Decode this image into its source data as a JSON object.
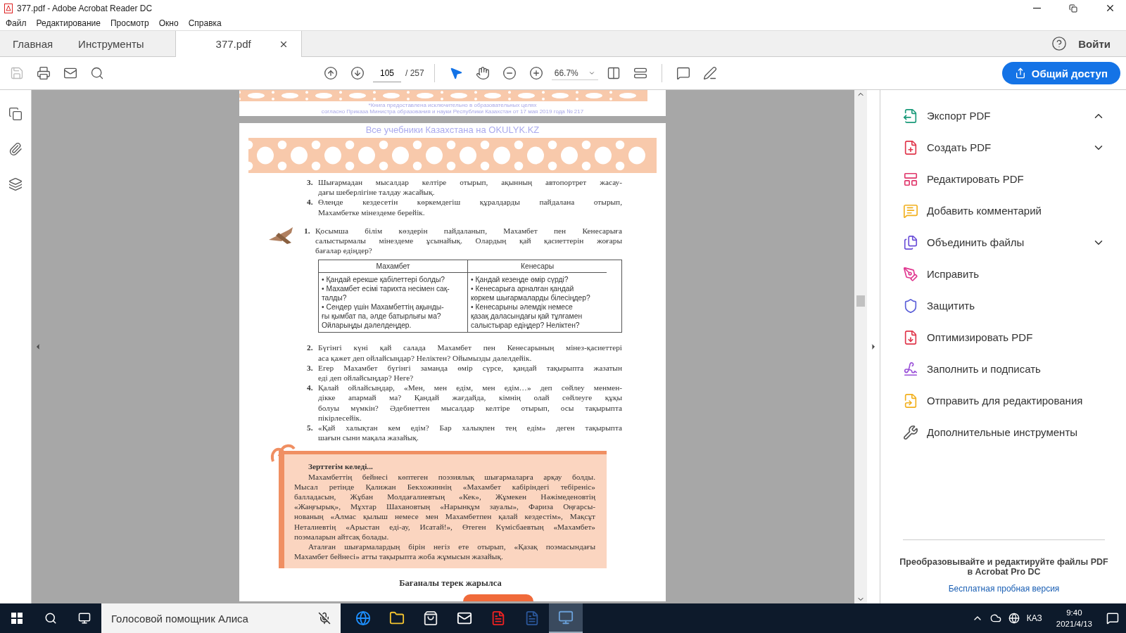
{
  "window": {
    "title": "377.pdf - Adobe Acrobat Reader DC"
  },
  "menu": [
    "Файл",
    "Редактирование",
    "Просмотр",
    "Окно",
    "Справка"
  ],
  "tabs": [
    {
      "label": "Главная",
      "selected": false,
      "kind": "nav"
    },
    {
      "label": "Инструменты",
      "selected": false,
      "kind": "nav"
    },
    {
      "label": "377.pdf",
      "selected": true,
      "kind": "document"
    }
  ],
  "sign_in": "Войти",
  "toolbar": {
    "page": "105",
    "page_total": "/ 257",
    "zoom": "66.7%",
    "share": "Общий доступ"
  },
  "document": {
    "notice": [
      "*Книга предоставлена исключительно в образовательных целях",
      "согласно Приказа Министра образования и науки Республики Казахстан от 17 мая 2019 года № 217"
    ],
    "watermark": "Все учебники Казахстана на OKULYK.KZ",
    "questions_a": [
      {
        "number": "3.",
        "lines": [
          "Шығармадан мысалдар келтіре отырып, ақынның автопортрет жасау-",
          "дағы шеберлігіне талдау жасайық."
        ]
      },
      {
        "number": "4.",
        "lines": [
          "Өлеңде кездесетін көркемдегіш құралдарды пайдалана отырып,",
          "Махамбетке мінездеме берейік."
        ]
      }
    ],
    "exercise": {
      "number": "1.",
      "lines": [
        "Қосымша білім көздерін пайдаланып, Махамбет пен Кенесарыға",
        "салыстырмалы мінездеме ұсынайық. Олардың қай қасиеттерін жоғары",
        "бағалар едіңдер?"
      ]
    },
    "table": {
      "columns": [
        "Махамбет",
        "Кенесары"
      ],
      "cells": [
        [
          "• Қандай ерекше қабілеттері болды?",
          "• Махамбет есімі тарихта несімен сақ-",
          "талды?",
          "• Сендер үшін Махамбеттің ақынды-",
          "ғы қымбат па, әлде батырлығы ма?",
          "Ойларыңды дәлелдеңдер."
        ],
        [
          "• Қандай кезеңде өмір сүрді?",
          "• Кенесарыға арналған қандай",
          "көркем шығармаларды білесіңдер?",
          "• Кенесарыны әлемдік немесе",
          "қазақ даласындағы қай тұлғамен",
          "салыстырар едіңдер? Неліктен?"
        ]
      ]
    },
    "questions_b": [
      {
        "number": "2.",
        "lines": [
          "Бүгінгі күні қай салада Махамбет пен Кенесарының мінез-қасиеттері",
          "аса қажет деп ойлайсыңдар? Неліктен? Ойымызды дәлелдейік."
        ]
      },
      {
        "number": "3.",
        "lines": [
          "Егер Махамбет бүгінгі заманда өмір сүрсе, қандай тақырыпта жазатын",
          "еді деп ойлайсыңдар? Неге?"
        ]
      },
      {
        "number": "4.",
        "lines": [
          "Қалай ойлайсыңдар, «Мен, мен едім, мен едім…» деп сөйлеу менмен-",
          "дікке апармай ма? Қандай жағдайда, кімнің олай сөйлеуге құқы",
          "болуы мүмкін? Әдебиеттен мысалдар келтіре отырып, осы тақырыпта",
          "пікірлесейік."
        ]
      },
      {
        "number": "5.",
        "lines": [
          "«Қай халықтан кем едім? Бар халықпен тең едім» деген тақырыпта",
          "шағын сыни мақала жазайық."
        ]
      }
    ],
    "research": {
      "title": "Зерттегім келеді...",
      "paragraphs": [
        [
          "Махамбеттің бейнесі көптеген поэзиялық шығармаларға арқау болды.",
          "Мысал ретінде Қалижан Бекхожиннің «Махамбет кабіріндегі тебіреніс»",
          "балладасын, Жұбан Молдағалиевтың «Кек», Жұмекен Нәжімеденовтің",
          "«Жаңғырық», Мұхтар Шахановтың «Нарынқұм зауалы», Фариза Оңғарсы-",
          "нованың «Алмас қылыш немесе мен Махамбетпен қалай кездестім», Мақсұт",
          "Неталиевтің «Арыстан еді-ау, Исатай!», Өтеген Күмісбаевтың «Махамбет»",
          "поэмаларын айтсақ болады."
        ],
        [
          "Аталған шығармалардың бірін негіз ете отырып, «Қазақ поэмасындағы",
          "Махамбет бейнесі» атты тақырыпта жоба жұмысын жазайық."
        ]
      ]
    },
    "next_heading": "Бағаналы терек жарылса"
  },
  "tools": [
    {
      "label": "Экспорт PDF",
      "color": "#1a9a7a",
      "expanded": true
    },
    {
      "label": "Создать PDF",
      "color": "#e0364b",
      "expanded": false
    },
    {
      "label": "Редактировать PDF",
      "color": "#e0366b"
    },
    {
      "label": "Добавить комментарий",
      "color": "#f2b01e"
    },
    {
      "label": "Объединить файлы",
      "color": "#6b4fd8",
      "expanded": false
    },
    {
      "label": "Исправить",
      "color": "#e0368f"
    },
    {
      "label": "Защитить",
      "color": "#5b5fd8"
    },
    {
      "label": "Оптимизировать PDF",
      "color": "#e0364b"
    },
    {
      "label": "Заполнить и подписать",
      "color": "#9a4fd8"
    },
    {
      "label": "Отправить для редактирования",
      "color": "#f2b01e"
    },
    {
      "label": "Дополнительные инструменты",
      "color": "#555555"
    }
  ],
  "promo": {
    "text": "Преобразовывайте и редактируйте файлы PDF в Acrobat Pro DC",
    "link": "Бесплатная пробная версия"
  },
  "taskbar": {
    "search_label": "Голосовой помощник Алиса",
    "apps": [
      {
        "selected": false
      },
      {
        "selected": false
      },
      {
        "selected": false
      },
      {
        "selected": false
      },
      {
        "selected": false
      },
      {
        "selected": false
      },
      {
        "selected": true
      }
    ],
    "language": "КАЗ",
    "time": "9:40",
    "date": "2021/4/13"
  }
}
